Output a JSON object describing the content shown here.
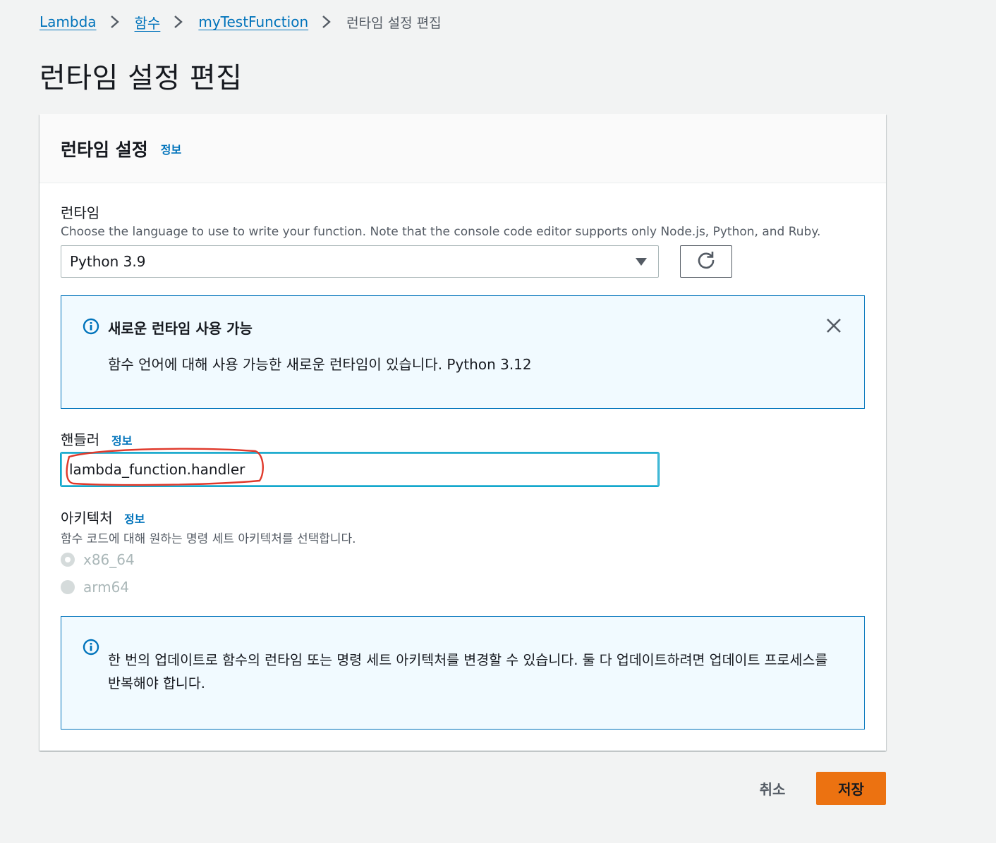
{
  "breadcrumb": {
    "items": [
      "Lambda",
      "함수",
      "myTestFunction"
    ],
    "current": "런타임 설정 편집"
  },
  "page_title": "런타임 설정 편집",
  "panel": {
    "title": "런타임 설정",
    "info": "정보"
  },
  "runtime": {
    "label": "런타임",
    "description": "Choose the language to use to write your function. Note that the console code editor supports only Node.js, Python, and Ruby.",
    "selected": "Python 3.9"
  },
  "new_runtime_alert": {
    "title": "새로운 런타임 사용 가능",
    "body": "함수 언어에 대해 사용 가능한 새로운 런타임이 있습니다. Python 3.12"
  },
  "handler": {
    "label": "핸들러",
    "info": "정보",
    "value": "lambda_function.handler"
  },
  "architecture": {
    "label": "아키텍처",
    "info": "정보",
    "description": "함수 코드에 대해 원하는 명령 세트 아키텍처를 선택합니다.",
    "options": [
      {
        "label": "x86_64",
        "checked": true
      },
      {
        "label": "arm64",
        "checked": false
      }
    ]
  },
  "update_alert": {
    "body_line1": "한 번의 업데이트로 함수의 런타임 또는 명령 세트 아키텍처를 변경할 수 있습니다. 둘 다 업데이트하려면 업데이트 프로세스를",
    "body_line2": "반복해야 합니다."
  },
  "footer": {
    "cancel": "취소",
    "save": "저장"
  },
  "colors": {
    "link": "#0073bb",
    "primary_button": "#ec7211",
    "alert_border": "#0073bb",
    "alert_bg": "#f1faff",
    "annotation": "#e0392b"
  },
  "icons": [
    "chevron-right-icon",
    "caret-down-icon",
    "refresh-icon",
    "info-icon",
    "close-icon"
  ]
}
